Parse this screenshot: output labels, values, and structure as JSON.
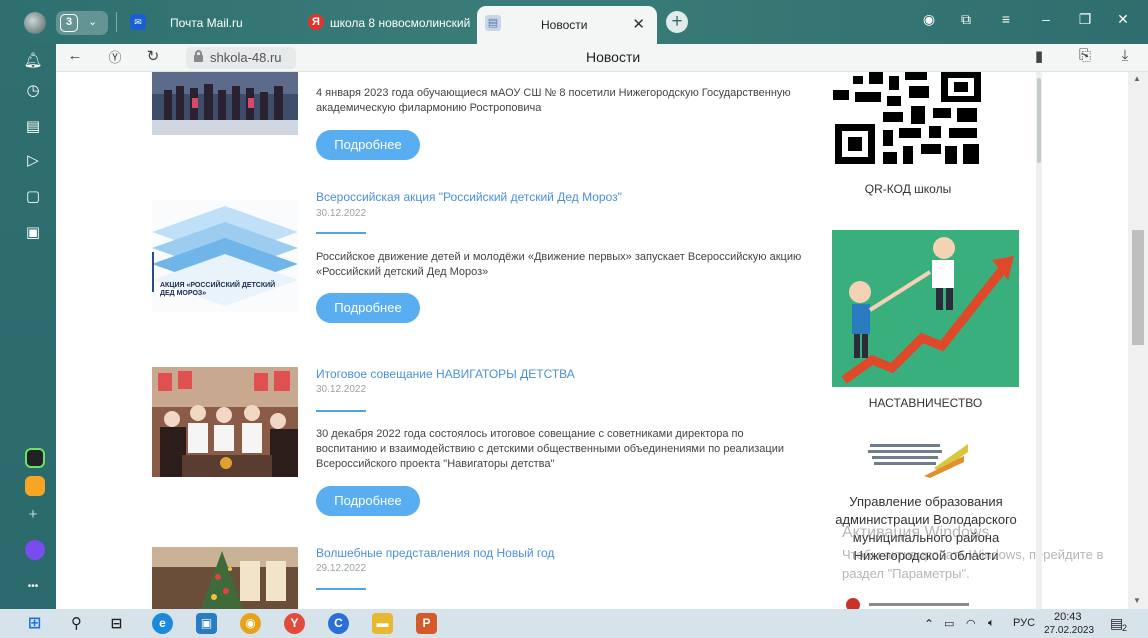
{
  "browser": {
    "tab_counter": "3",
    "tabs": [
      {
        "title": "Почта Mail.ru",
        "favicon": "mail-icon"
      },
      {
        "title": "школа 8 новосмолинский",
        "favicon": "yandex-icon"
      },
      {
        "title": "Новости",
        "favicon": "page-icon",
        "active": true
      }
    ],
    "address": {
      "domain": "shkola-48.ru",
      "page_title": "Новости"
    }
  },
  "news": [
    {
      "text": "4 января 2023 года обучающиеся мАОУ СШ № 8 посетили Нижегородскую Государственную академическую филармонию Ростроповича",
      "button": "Подробнее"
    },
    {
      "title": "Всероссийская акция \"Российский детский Дед Мороз\"",
      "date": "30.12.2022",
      "text": "Российское движение детей и молодёжи «Движение первых» запускает Всероссийскую акцию «Российский детский Дед Мороз»",
      "button": "Подробнее",
      "thumb_text": "АКЦИЯ «РОССИЙСКИЙ ДЕТСКИЙ ДЕД МОРОЗ»"
    },
    {
      "title": "Итоговое совещание НАВИГАТОРЫ ДЕТСТВА",
      "date": "30.12.2022",
      "text": "30 декабря 2022 года состоялось итоговое совещание с советниками директора по воспитанию и взаимодействию с детскими общественными объединениями по реализации Всероссийского проекта \"Навигаторы детства\"",
      "button": "Подробнее"
    },
    {
      "title": "Волшебные представления под Новый год",
      "date": "29.12.2022"
    }
  ],
  "sidebar_right": {
    "qr_caption": "QR-КОД школы",
    "mentoring_caption": "НАСТАВНИЧЕСТВО",
    "edu_caption": "Управление образования администрации Володарского муниципального района Нижегородской области"
  },
  "watermark": {
    "line1": "Активация Windows",
    "line2": "Чтобы активировать Windows, перейдите в",
    "line3": "раздел \"Параметры\"."
  },
  "taskbar": {
    "lang": "РУС",
    "time": "20:43",
    "date": "27.02.2023",
    "notifications": "2"
  },
  "colors": {
    "accent": "#58aef0",
    "link": "#4a90d9",
    "sidebar": "#2f6f6f"
  }
}
